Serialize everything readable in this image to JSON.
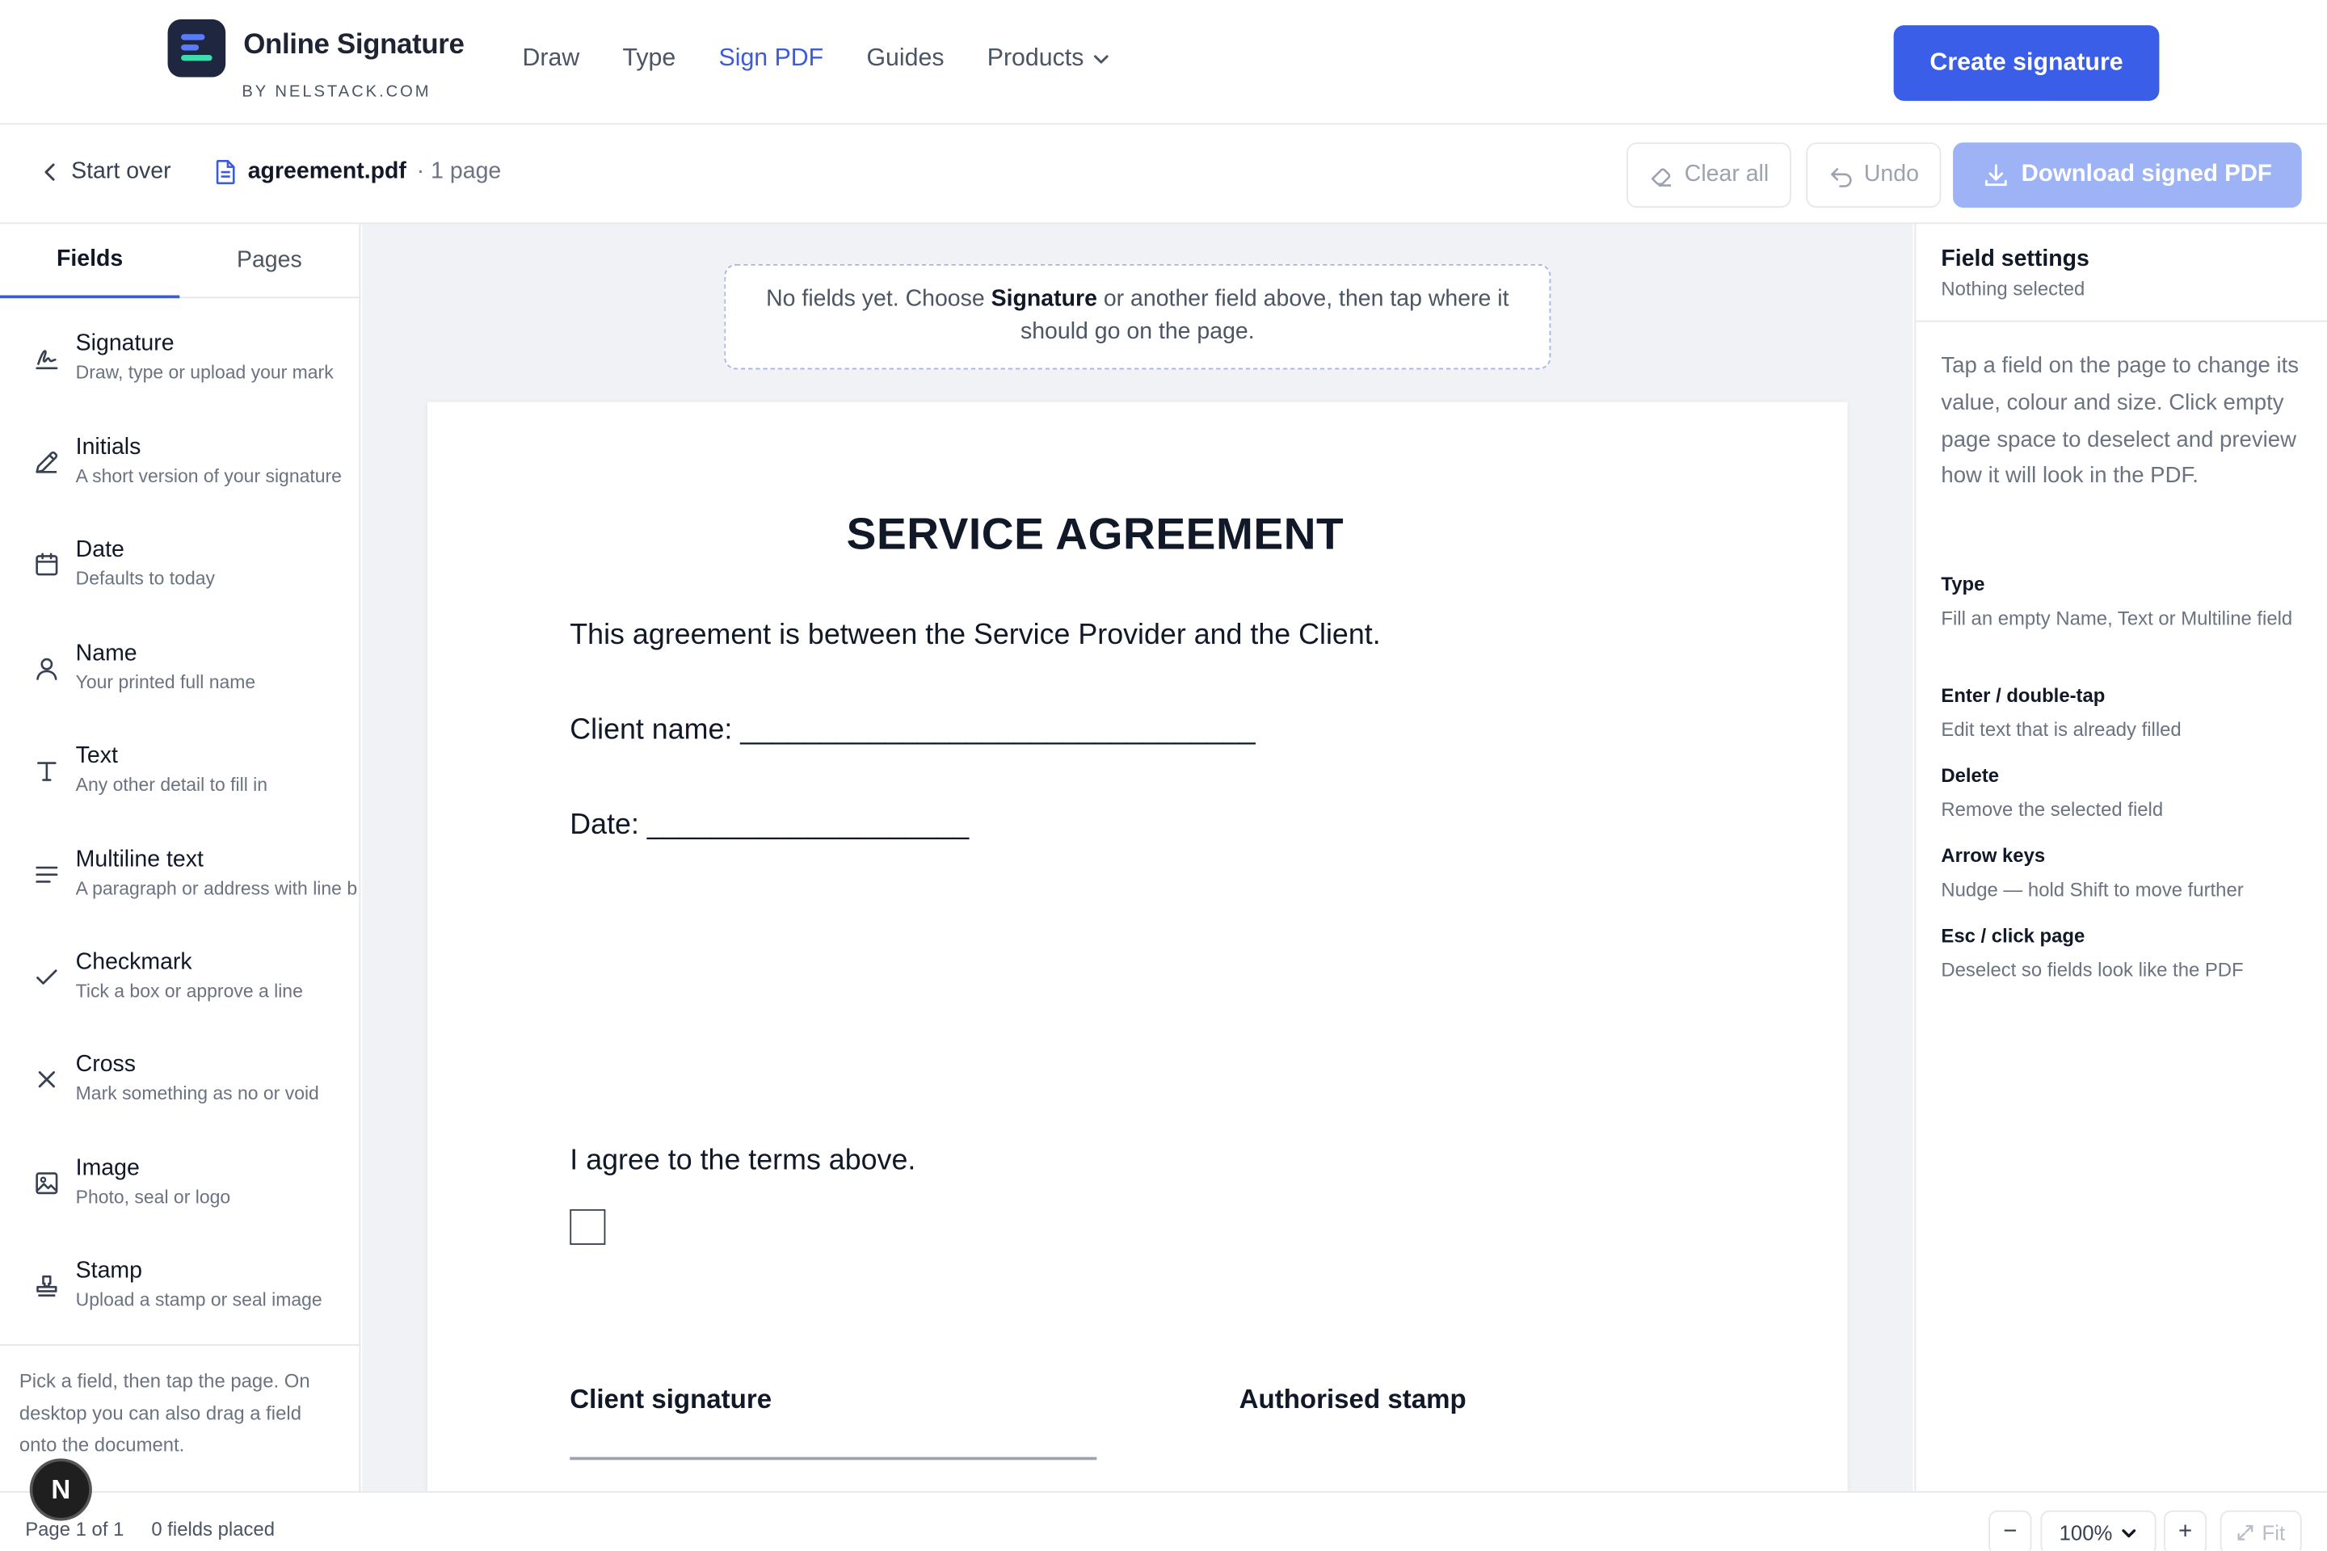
{
  "brand": {
    "name": "Online Signature",
    "sub": "BY NELSTACK.COM"
  },
  "nav": {
    "draw": "Draw",
    "type": "Type",
    "sign_pdf": "Sign PDF",
    "guides": "Guides",
    "products": "Products"
  },
  "header": {
    "create_label": "Create signature"
  },
  "toolbar": {
    "start_over": "Start over",
    "filename": "agreement.pdf",
    "page_count": "· 1 page",
    "clear_all": "Clear all",
    "undo": "Undo",
    "download": "Download signed PDF"
  },
  "left": {
    "tabs": [
      "Fields",
      "Pages"
    ],
    "fields": [
      {
        "title": "Signature",
        "desc": "Draw, type or upload your mark"
      },
      {
        "title": "Initials",
        "desc": "A short version of your signature"
      },
      {
        "title": "Date",
        "desc": "Defaults to today"
      },
      {
        "title": "Name",
        "desc": "Your printed full name"
      },
      {
        "title": "Text",
        "desc": "Any other detail to fill in"
      },
      {
        "title": "Multiline text",
        "desc": "A paragraph or address with line b"
      },
      {
        "title": "Checkmark",
        "desc": "Tick a box or approve a line"
      },
      {
        "title": "Cross",
        "desc": "Mark something as no or void"
      },
      {
        "title": "Image",
        "desc": "Photo, seal or logo"
      },
      {
        "title": "Stamp",
        "desc": "Upload a stamp or seal image"
      }
    ],
    "help": "Pick a field, then tap the page. On desktop you can also drag a field onto the document."
  },
  "canvas": {
    "hint_pre": "No fields yet. Choose ",
    "hint_bold": "Signature",
    "hint_post": " or another field above, then tap where it should go on the page.",
    "doc": {
      "title": "SERVICE AGREEMENT",
      "intro": "This agreement is between the Service Provider and the Client.",
      "client_name": "Client name: ________________________________",
      "date": "Date: ____________________",
      "agree": "I agree to the terms above.",
      "client_signature": "Client signature",
      "authorised_stamp": "Authorised stamp"
    }
  },
  "right": {
    "title": "Field settings",
    "subtitle": "Nothing selected",
    "intro": "Tap a field on the page to change its value, colour and size. Click empty page space to deselect and preview how it will look in the PDF.",
    "shortcuts": [
      {
        "key": "Type",
        "desc": "Fill an empty Name, Text or Multiline field"
      },
      {
        "key": "Enter / double-tap",
        "desc": "Edit text that is already filled"
      },
      {
        "key": "Delete",
        "desc": "Remove the selected field"
      },
      {
        "key": "Arrow keys",
        "desc": "Nudge — hold Shift to move further"
      },
      {
        "key": "Esc / click page",
        "desc": "Deselect so fields look like the PDF"
      }
    ]
  },
  "status": {
    "page": "Page 1 of 1",
    "fields_placed": "0 fields placed",
    "zoom": "100%",
    "zoom_out": "−",
    "zoom_in": "+",
    "fit": "Fit"
  },
  "avatar": {
    "letter": "N"
  },
  "colors": {
    "accent": "#3b5ee8",
    "accent_light": "#9db3f5",
    "nav_active": "#3b5bdb"
  }
}
